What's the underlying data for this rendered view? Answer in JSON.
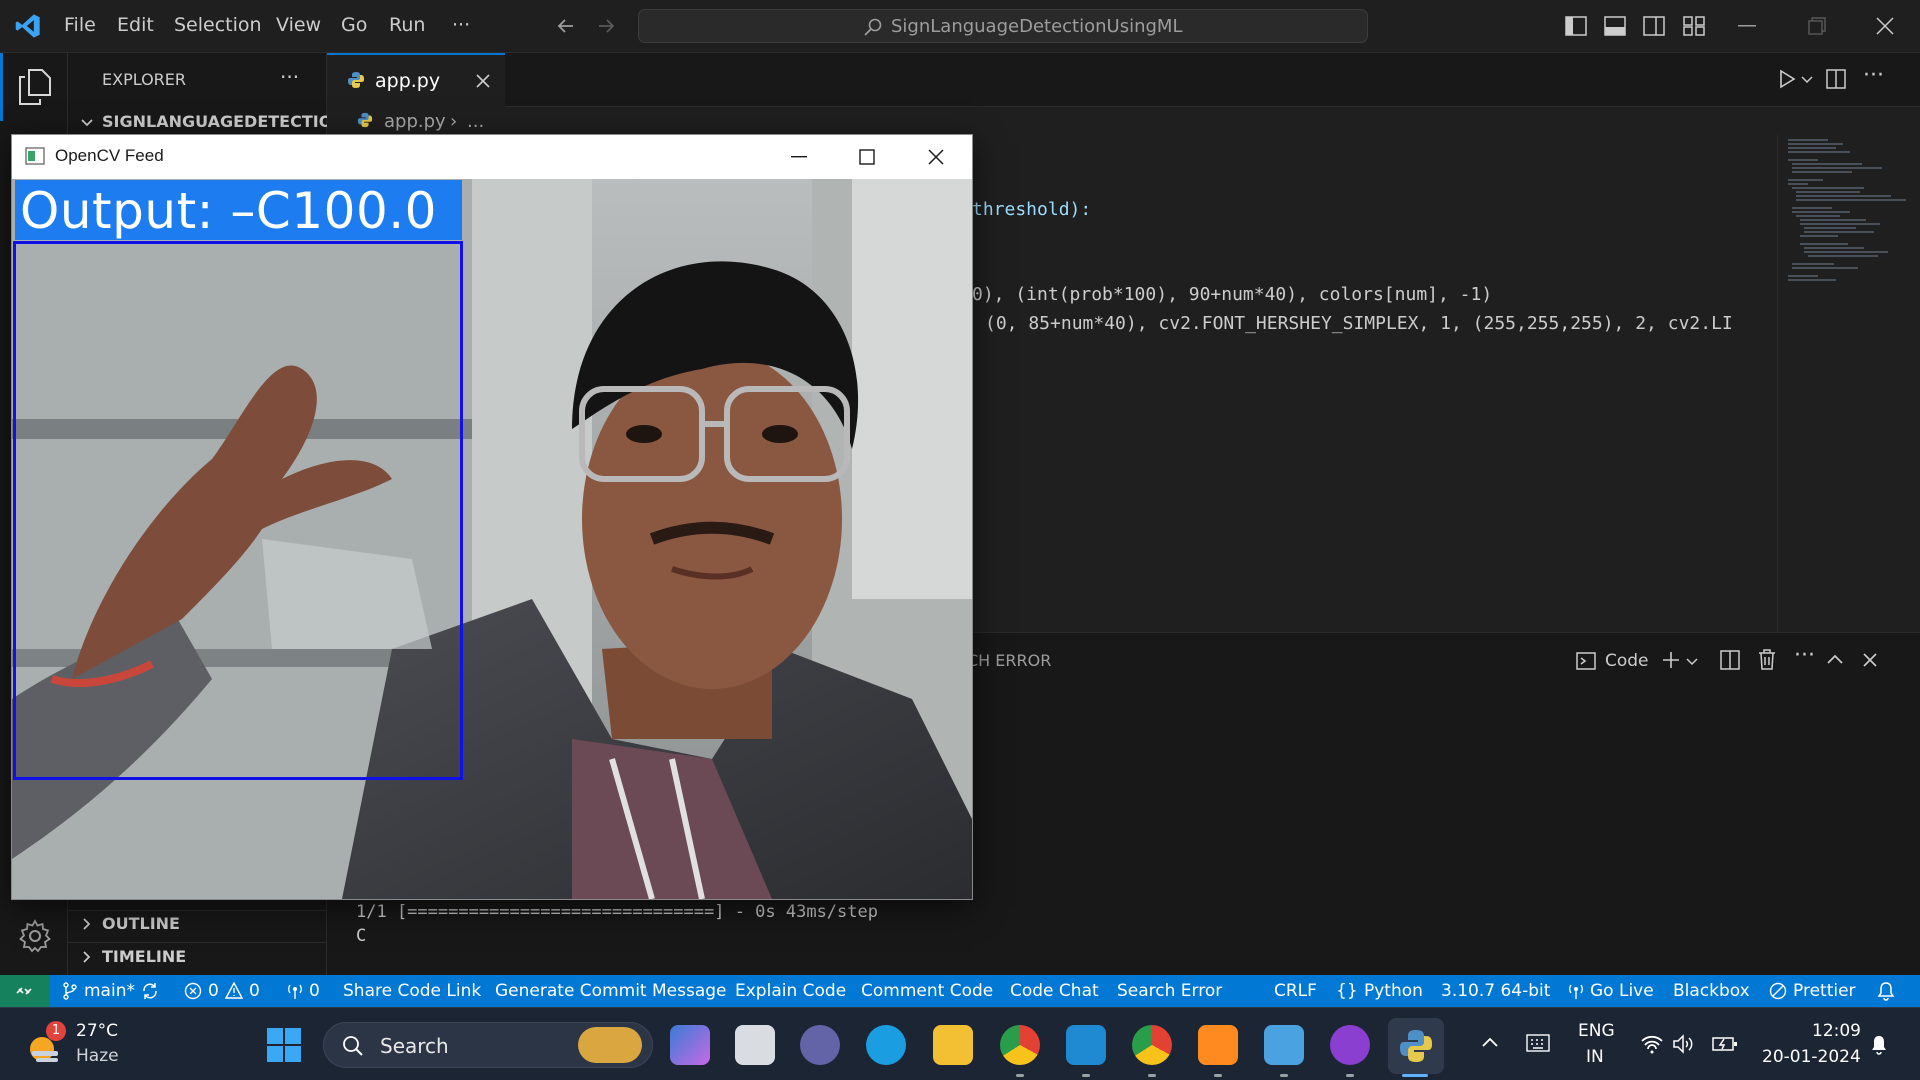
{
  "titlebar": {
    "menu": [
      "File",
      "Edit",
      "Selection",
      "View",
      "Go",
      "Run",
      "···"
    ],
    "search": "SignLanguageDetectionUsingML"
  },
  "sidebar": {
    "explorer_title": "EXPLORER",
    "explorer_more": "···",
    "project": "SIGNLANGUAGEDETECTIO...",
    "outline": "OUTLINE",
    "timeline": "TIMELINE"
  },
  "editor": {
    "tab_label": "app.py",
    "breadcrumb_file": "app.py",
    "breadcrumb_rest": "...",
    "lines": [
      "threshold):",
      "0), (int(prob*100), 90+num*40), colors[num], -1)",
      "(0, 85+num*40), cv2.FONT_HERSHEY_SIMPLEX, 1, (255,255,255), 2, cv2.LI"
    ]
  },
  "panel": {
    "tab_fragment": "CH ERROR",
    "terminal_label": "Code",
    "terminal_lines": [
      "1/1 [==============================] - 0s 43ms/step",
      "C"
    ]
  },
  "statusbar": {
    "branch": "main*",
    "errors": "0",
    "warnings": "0",
    "ports": "0",
    "items": [
      "Share Code Link",
      "Generate Commit Message",
      "Explain Code",
      "Comment Code",
      "Code Chat",
      "Search Error"
    ],
    "eol": "CRLF",
    "language": "Python",
    "interpreter": "3.10.7 64-bit",
    "golive": "Go Live",
    "blackbox": "Blackbox",
    "prettier": "Prettier"
  },
  "opencv": {
    "window_title": "OpenCV Feed",
    "output_text": "Output: –C100.0"
  },
  "taskbar": {
    "weather_temp": "27°C",
    "weather_desc": "Haze",
    "weather_badge": "1",
    "search": "Search",
    "lang_line1": "ENG",
    "lang_line2": "IN",
    "time": "12:09",
    "date": "20-01-2024"
  },
  "colors": {
    "accent": "#0078d4",
    "statusbar": "#0078d4",
    "cv_output_bar": "#1d7df0",
    "cv_roi": "#1010e8"
  }
}
